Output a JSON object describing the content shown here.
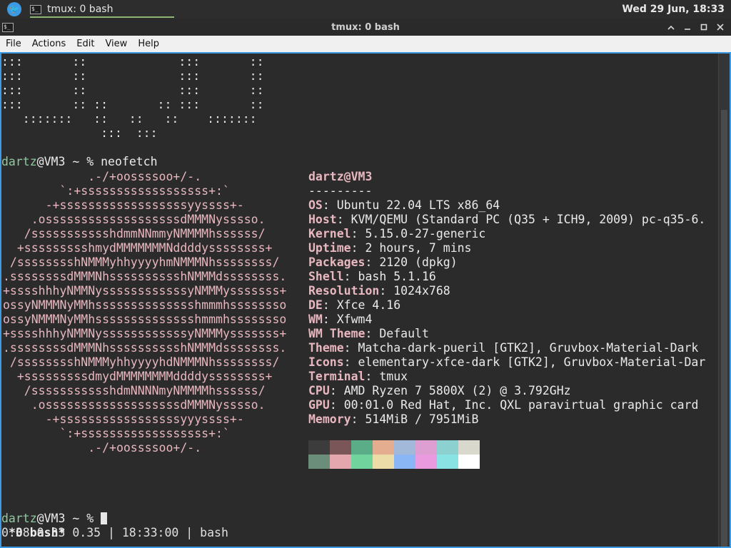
{
  "panel": {
    "task_label": "tmux: 0 bash",
    "clock": "Wed 29 Jun, 18:33"
  },
  "window": {
    "title": "tmux: 0 bash"
  },
  "menu": {
    "items": [
      "File",
      "Actions",
      "Edit",
      "View",
      "Help"
    ]
  },
  "terminal": {
    "banner": [
      ":::       ::             :::       ::",
      ":::       ::             :::       ::",
      ":::       ::             :::       ::",
      ":::       :: ::       :: :::       ::",
      "   :::::::   ::   ::   ::    :::::::",
      "              :::  :::"
    ],
    "prompt_user": "dartz",
    "prompt_rest": "@VM3 ~ % ",
    "command": "neofetch",
    "logo": [
      "            .-/+oossssoo+/-.",
      "        `:+ssssssssssssssssss+:`",
      "      -+ssssssssssssssssssyyssss+-",
      "    .osssssssssssssssssssdMMMNysssso.",
      "   /ssssssssssshdmmNNmmyNMMMMhssssss/",
      "  +ssssssssshmydMMMMMMMNddddyssssssss+",
      " /sssssssshNMMMyhhyyyyhmNMMMNhssssssss/",
      ".ssssssssdMMMNhsssssssssshNMMMdssssssss.",
      "+sssshhhyNMMNyssssssssssssyNMMMysssssss+",
      "ossyNMMMNyMMhsssssssssssssshmmmhssssssso",
      "ossyNMMMNyMMhsssssssssssssshmmmhssssssso",
      "+sssshhhyNMMNyssssssssssssyNMMMysssssss+",
      ".ssssssssdMMMNhsssssssssshNMMMdssssssss.",
      " /sssssssshNMMMyhhyyyyhdNMMMNhssssssss/",
      "  +sssssssssdmydMMMMMMMMddddyssssssss+",
      "   /ssssssssssshdmNNNNmyNMMMMhssssss/",
      "    .osssssssssssssssssssdMMMNysssso.",
      "      -+sssssssssssssssssyyyssss+-",
      "        `:+ssssssssssssssssss+:`",
      "            .-/+oossssoo+/-."
    ],
    "info_header": "dartz@VM3",
    "info_sep": "---------",
    "info": [
      {
        "label": "OS",
        "value": "Ubuntu 22.04 LTS x86_64"
      },
      {
        "label": "Host",
        "value": "KVM/QEMU (Standard PC (Q35 + ICH9, 2009) pc-q35-6."
      },
      {
        "label": "Kernel",
        "value": "5.15.0-27-generic"
      },
      {
        "label": "Uptime",
        "value": "2 hours, 7 mins"
      },
      {
        "label": "Packages",
        "value": "2120 (dpkg)"
      },
      {
        "label": "Shell",
        "value": "bash 5.1.16"
      },
      {
        "label": "Resolution",
        "value": "1024x768"
      },
      {
        "label": "DE",
        "value": "Xfce 4.16"
      },
      {
        "label": "WM",
        "value": "Xfwm4"
      },
      {
        "label": "WM Theme",
        "value": "Default"
      },
      {
        "label": "Theme",
        "value": "Matcha-dark-pueril [GTK2], Gruvbox-Material-Dark"
      },
      {
        "label": "Icons",
        "value": "elementary-xfce-dark [GTK2], Gruvbox-Material-Dar"
      },
      {
        "label": "Terminal",
        "value": "tmux"
      },
      {
        "label": "CPU",
        "value": "AMD Ryzen 7 5800X (2) @ 3.792GHz"
      },
      {
        "label": "GPU",
        "value": "00:01.0 Red Hat, Inc. QXL paravirtual graphic card"
      },
      {
        "label": "Memory",
        "value": "514MiB / 7951MiB"
      }
    ],
    "palette_row1": [
      "#3c3c3c",
      "#7a5658",
      "#5aad86",
      "#e4ad8f",
      "#a3b9d9",
      "#dd9ed2",
      "#8cd0d0",
      "#d8d8cc"
    ],
    "palette_row2": [
      "#6a8e7a",
      "#e4a7ad",
      "#72d49d",
      "#ecdca8",
      "#8bb6f5",
      "#ea9bdf",
      "#89e3e3",
      "#ffffff"
    ],
    "status_left": "*0 bash*",
    "status_right": "0.38 0.33 0.35 | 18:33:00 | bash"
  },
  "colors": {
    "accent": "#3d9be3",
    "prompt_green": "#8fc9a0",
    "pink": "#e8b7bf",
    "background": "#2b2b2b"
  }
}
